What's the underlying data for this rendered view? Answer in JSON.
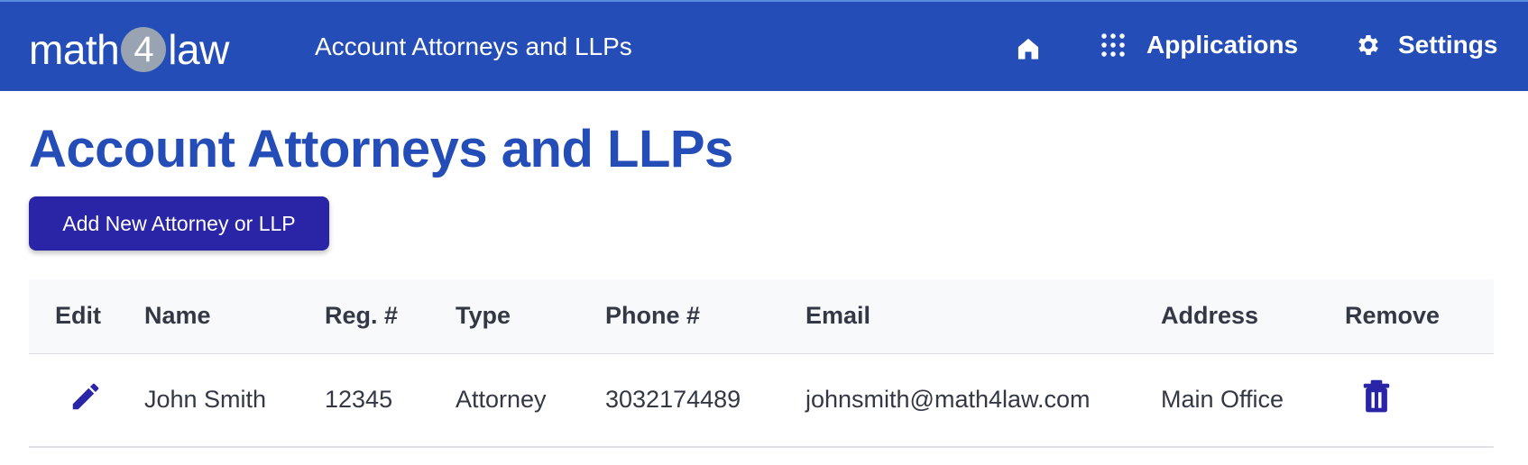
{
  "navbar": {
    "logo": {
      "text_before": "math",
      "number": "4",
      "text_after": "law"
    },
    "title": "Account Attorneys and LLPs",
    "home_icon": "home-icon",
    "applications_label": "Applications",
    "applications_icon": "grid-dots-icon",
    "settings_label": "Settings",
    "settings_icon": "gear-icon",
    "background_color": "#244db7"
  },
  "page": {
    "title": "Account Attorneys and LLPs",
    "title_color": "#244db7",
    "add_button_label": "Add New Attorney or LLP",
    "add_button_color": "#2a25a6"
  },
  "table": {
    "headers": {
      "edit": "Edit",
      "name": "Name",
      "reg": "Reg. #",
      "type": "Type",
      "phone": "Phone #",
      "email": "Email",
      "address": "Address",
      "remove": "Remove"
    },
    "rows": [
      {
        "name": "John Smith",
        "reg": "12345",
        "type": "Attorney",
        "phone": "3032174489",
        "email": "johnsmith@math4law.com",
        "address": "Main Office",
        "edit_icon": "pencil-icon",
        "remove_icon": "trash-icon"
      }
    ],
    "icon_color": "#2a25a6"
  }
}
